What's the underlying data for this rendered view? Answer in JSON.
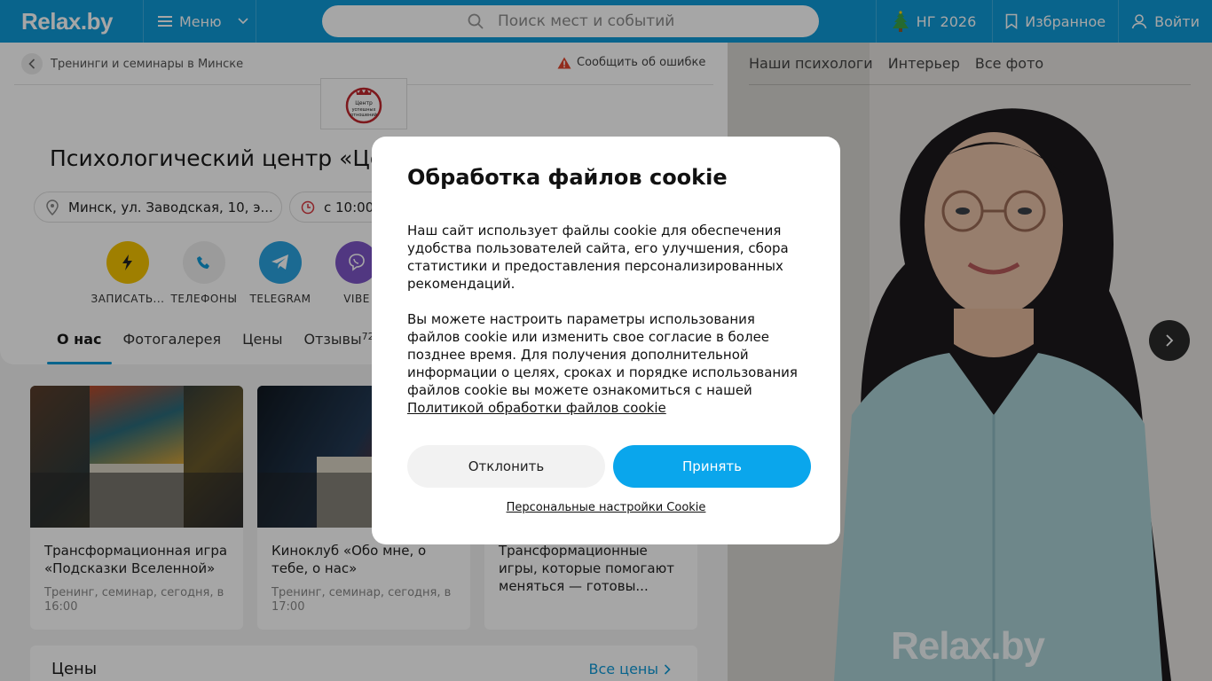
{
  "header": {
    "logo": "Relax.by",
    "menu_label": "Меню",
    "search_placeholder": "Поиск мест и событий",
    "ny_label": "НГ 2026",
    "favorites_label": "Избранное",
    "login_label": "Войти",
    "colors": {
      "brand": "#0e9ad8"
    }
  },
  "breadcrumb": {
    "label": "Тренинги и семинары в Минске"
  },
  "report_error": "Сообщить об ошибке",
  "place": {
    "title": "Психологический центр «Це",
    "address": "Минск, ул. Заводская, 10, э...",
    "hours": "с 10:00"
  },
  "actions": [
    {
      "label": "ЗАПИСАТЬ...",
      "color": "#f5c400"
    },
    {
      "label": "ТЕЛЕФОНЫ",
      "color": "#eeeeee"
    },
    {
      "label": "TELEGRAM",
      "color": "#2aa3e0"
    },
    {
      "label": "VIBE",
      "color": "#7d55c7"
    }
  ],
  "tabs": [
    {
      "label": "О нас",
      "active": true
    },
    {
      "label": "Фотогалерея"
    },
    {
      "label": "Цены"
    },
    {
      "label": "Отзывы",
      "count": "72"
    }
  ],
  "events": [
    {
      "title": "Трансформационная игра «Подсказки Вселенной»",
      "meta": "Тренинг, семинар, сегодня, в 16:00"
    },
    {
      "title": "Киноклуб «Обо мне, о тебе, о нас»",
      "meta": "Тренинг, семинар, сегодня, в 17:00"
    },
    {
      "title": "Трансформационные игры, которые помогают меняться — готовы...",
      "meta": ""
    }
  ],
  "prices": {
    "heading": "Цены",
    "all_link": "Все цены"
  },
  "gallery": {
    "tabs": [
      "Наши психологи",
      "Интерьер",
      "Все фото"
    ],
    "watermark": "Relax.by"
  },
  "cookie": {
    "title": "Обработка файлов cookie",
    "para1": "Наш сайт использует файлы cookie для обеспечения удобства пользователей сайта, его улучшения, сбора статистики и предоставления персонализированных рекомендаций.",
    "para2": "Вы можете настроить параметры использования файлов cookie или изменить свое согласие в более позднее время. Для получения дополнительной информации о целях, сроках и порядке использования файлов cookie вы можете ознакомиться с нашей",
    "policy_link": "Политикой обработки файлов cookie",
    "decline": "Отклонить",
    "accept": "Принять",
    "settings": "Персональные настройки Cookie"
  }
}
